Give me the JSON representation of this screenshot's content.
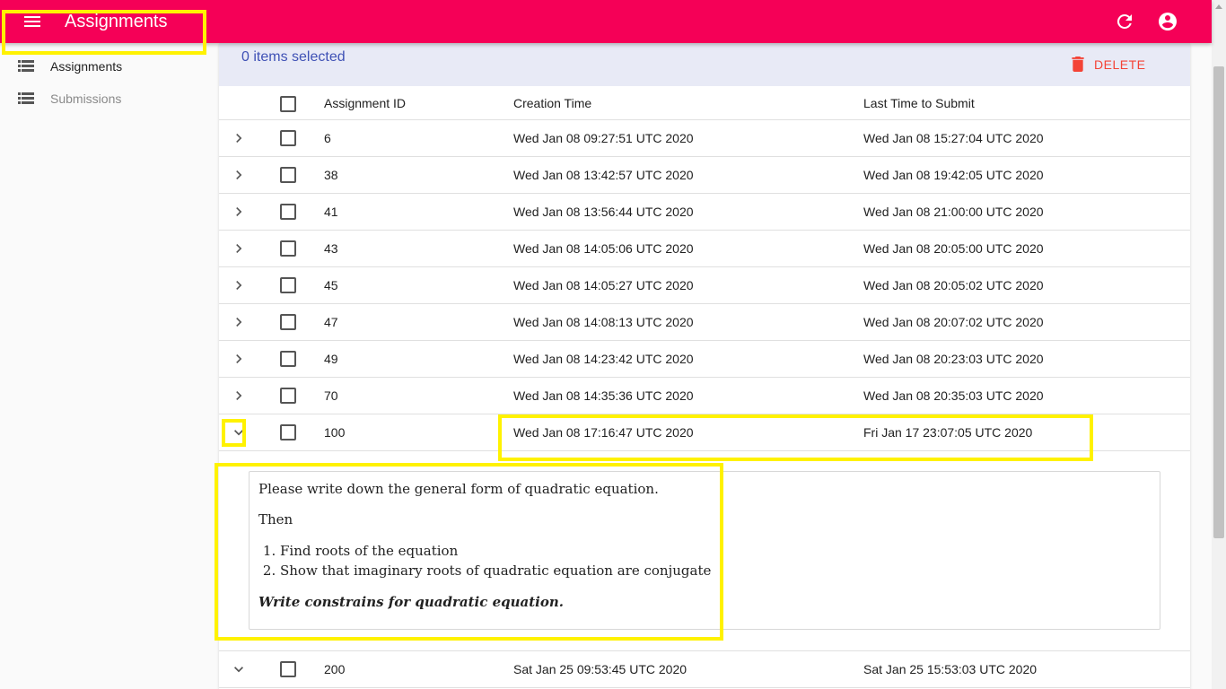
{
  "app": {
    "title": "Assignments"
  },
  "sidebar": {
    "items": [
      {
        "label": "Assignments",
        "icon": "list-icon",
        "active": true
      },
      {
        "label": "Submissions",
        "icon": "list-icon",
        "active": false
      }
    ]
  },
  "toolbar": {
    "selection_text": "0 items selected",
    "delete_label": "DELETE"
  },
  "table": {
    "columns": [
      "Assignment ID",
      "Creation Time",
      "Last Time to Submit"
    ],
    "rows": [
      {
        "id": "6",
        "creation": "Wed Jan 08 09:27:51 UTC 2020",
        "deadline": "Wed Jan 08 15:27:04 UTC 2020",
        "expanded": false
      },
      {
        "id": "38",
        "creation": "Wed Jan 08 13:42:57 UTC 2020",
        "deadline": "Wed Jan 08 19:42:05 UTC 2020",
        "expanded": false
      },
      {
        "id": "41",
        "creation": "Wed Jan 08 13:56:44 UTC 2020",
        "deadline": "Wed Jan 08 21:00:00 UTC 2020",
        "expanded": false
      },
      {
        "id": "43",
        "creation": "Wed Jan 08 14:05:06 UTC 2020",
        "deadline": "Wed Jan 08 20:05:00 UTC 2020",
        "expanded": false
      },
      {
        "id": "45",
        "creation": "Wed Jan 08 14:05:27 UTC 2020",
        "deadline": "Wed Jan 08 20:05:02 UTC 2020",
        "expanded": false
      },
      {
        "id": "47",
        "creation": "Wed Jan 08 14:08:13 UTC 2020",
        "deadline": "Wed Jan 08 20:07:02 UTC 2020",
        "expanded": false
      },
      {
        "id": "49",
        "creation": "Wed Jan 08 14:23:42 UTC 2020",
        "deadline": "Wed Jan 08 20:23:03 UTC 2020",
        "expanded": false
      },
      {
        "id": "70",
        "creation": "Wed Jan 08 14:35:36 UTC 2020",
        "deadline": "Wed Jan 08 20:35:03 UTC 2020",
        "expanded": false
      },
      {
        "id": "100",
        "creation": "Wed Jan 08 17:16:47 UTC 2020",
        "deadline": "Fri Jan 17 23:07:05 UTC 2020",
        "expanded": true
      },
      {
        "id": "200",
        "creation": "Sat Jan 25 09:53:45 UTC 2020",
        "deadline": "Sat Jan 25 15:53:03 UTC 2020",
        "expanded": true
      }
    ],
    "detail": {
      "line1": "Please write down the general form of quadratic equation.",
      "line2": "Then",
      "list": [
        "Find roots of the equation",
        "Show that imaginary roots of quadratic equation are  conjugate"
      ],
      "emphasis": "Write constrains for quadratic equation."
    }
  },
  "colors": {
    "appbar": "#f50057",
    "toolbar_bg": "#e8eaf6",
    "selection_text": "#3f51b5",
    "delete": "#f44336",
    "highlight": "#fff200"
  }
}
